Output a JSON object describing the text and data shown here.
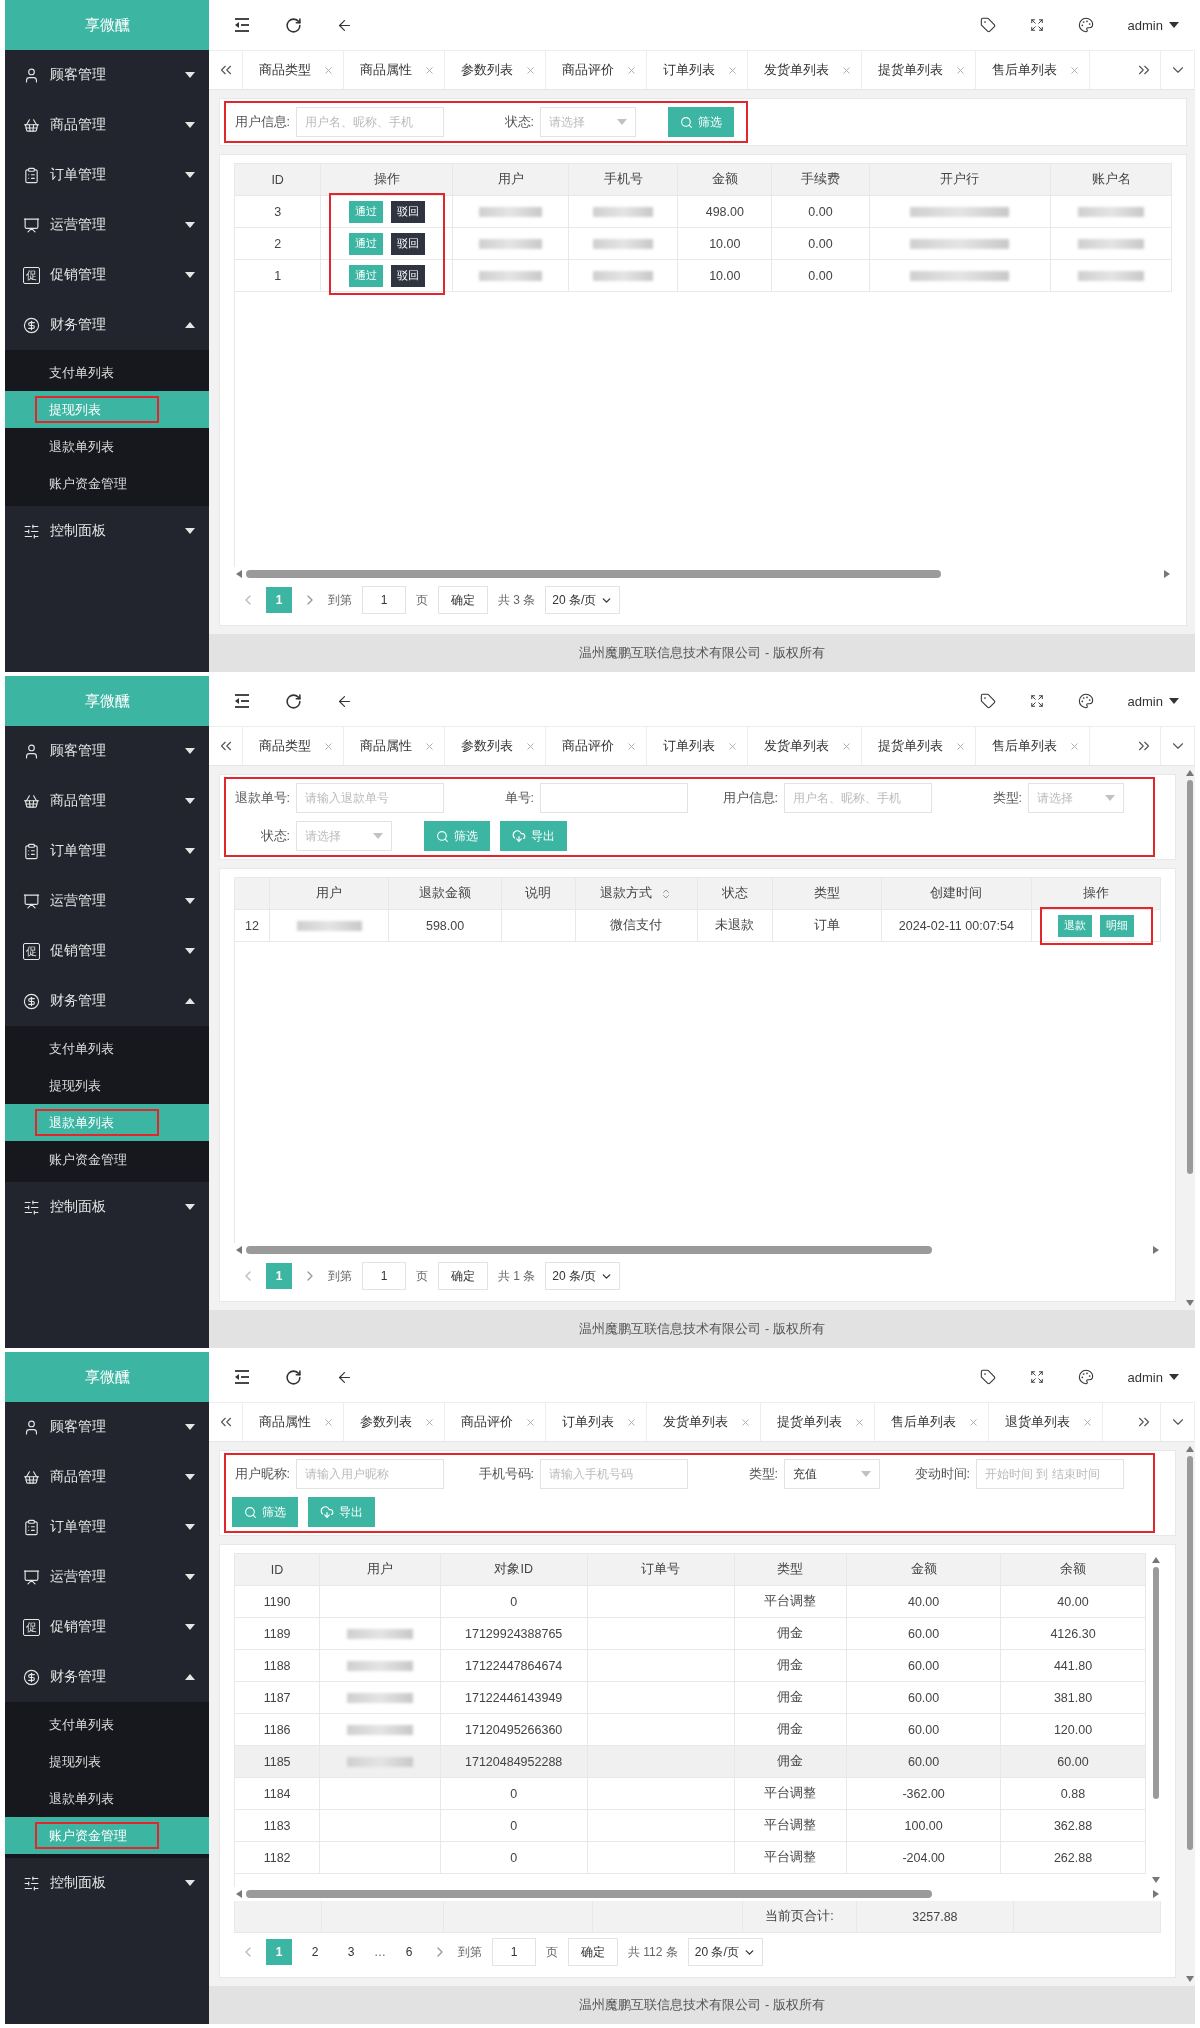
{
  "panels": [
    {
      "brand": "享微醺",
      "user": "admin",
      "content_scrollbar": false,
      "menu": [
        {
          "label": "顾客管理",
          "kind": "user",
          "expanded": false
        },
        {
          "label": "商品管理",
          "kind": "basket",
          "expanded": false
        },
        {
          "label": "订单管理",
          "kind": "clipboard",
          "expanded": false
        },
        {
          "label": "运营管理",
          "kind": "presentation",
          "expanded": false
        },
        {
          "label": "促销管理",
          "kind": "glyph",
          "glyph": "促",
          "expanded": false
        },
        {
          "label": "财务管理",
          "kind": "finance",
          "expanded": true,
          "children": [
            {
              "label": "支付单列表",
              "selected": false,
              "highlighted": false
            },
            {
              "label": "提现列表",
              "selected": true,
              "highlighted": true
            },
            {
              "label": "退款单列表",
              "selected": false,
              "highlighted": false
            },
            {
              "label": "账户资金管理",
              "selected": false,
              "highlighted": false
            }
          ]
        },
        {
          "label": "控制面板",
          "kind": "panel",
          "expanded": false
        }
      ],
      "tabs": [
        "商品类型",
        "商品属性",
        "参数列表",
        "商品评价",
        "订单列表",
        "发货单列表",
        "提货单列表",
        "售后单列表"
      ],
      "filters": {
        "highlighted": true,
        "fields": [
          {
            "kind": "input",
            "label": "用户信息:",
            "placeholder": "用户名、昵称、手机"
          },
          {
            "kind": "select",
            "label": "状态:",
            "placeholder": "请选择"
          }
        ],
        "buttons": [
          {
            "kind": "search",
            "label": "筛选"
          }
        ]
      },
      "table": {
        "vertical_scrollbar": false,
        "columns": [
          {
            "label": "ID",
            "sortable": false,
            "highlighted": false
          },
          {
            "label": "操作",
            "sortable": false,
            "highlighted": true
          },
          {
            "label": "用户",
            "sortable": false,
            "highlighted": false
          },
          {
            "label": "手机号",
            "sortable": false,
            "highlighted": false
          },
          {
            "label": "金额",
            "sortable": false,
            "highlighted": false
          },
          {
            "label": "手续费",
            "sortable": false,
            "highlighted": false
          },
          {
            "label": "开户行",
            "sortable": false,
            "highlighted": false
          },
          {
            "label": "账户名",
            "sortable": false,
            "highlighted": false
          }
        ],
        "rows": [
          {
            "highlighted": false,
            "cells": [
              "3",
              {
                "kind": "actions",
                "buttons": [
                  {
                    "label": "通过",
                    "kind": "primary"
                  },
                  {
                    "label": "驳回",
                    "kind": "dark"
                  }
                ]
              },
              {
                "kind": "blurred"
              },
              {
                "kind": "blurred"
              },
              "498.00",
              "0.00",
              {
                "kind": "blurred"
              },
              {
                "kind": "blurred"
              }
            ]
          },
          {
            "highlighted": false,
            "cells": [
              "2",
              {
                "kind": "actions",
                "buttons": [
                  {
                    "label": "通过",
                    "kind": "primary"
                  },
                  {
                    "label": "驳回",
                    "kind": "dark"
                  }
                ]
              },
              {
                "kind": "blurred"
              },
              {
                "kind": "blurred"
              },
              "10.00",
              "0.00",
              {
                "kind": "blurred"
              },
              {
                "kind": "blurred"
              }
            ]
          },
          {
            "highlighted": false,
            "cells": [
              "1",
              {
                "kind": "actions",
                "buttons": [
                  {
                    "label": "通过",
                    "kind": "primary"
                  },
                  {
                    "label": "驳回",
                    "kind": "dark"
                  }
                ]
              },
              {
                "kind": "blurred"
              },
              {
                "kind": "blurred"
              },
              "10.00",
              "0.00",
              {
                "kind": "blurred"
              },
              {
                "kind": "blurred"
              }
            ]
          }
        ]
      },
      "pagination": {
        "pages": [
          {
            "kind": "page",
            "label": "1",
            "selected": true
          }
        ],
        "goto_label": "到第",
        "goto_value": "1",
        "goto_suffix": "页",
        "confirm": "确定",
        "total": "共 3 条",
        "page_size": "20 条/页"
      },
      "footer": "温州魔鹏互联信息技术有限公司 - 版权所有"
    },
    {
      "brand": "享微醺",
      "user": "admin",
      "content_scrollbar": true,
      "menu": [
        {
          "label": "顾客管理",
          "kind": "user",
          "expanded": false
        },
        {
          "label": "商品管理",
          "kind": "basket",
          "expanded": false
        },
        {
          "label": "订单管理",
          "kind": "clipboard",
          "expanded": false
        },
        {
          "label": "运营管理",
          "kind": "presentation",
          "expanded": false
        },
        {
          "label": "促销管理",
          "kind": "glyph",
          "glyph": "促",
          "expanded": false
        },
        {
          "label": "财务管理",
          "kind": "finance",
          "expanded": true,
          "children": [
            {
              "label": "支付单列表",
              "selected": false,
              "highlighted": false
            },
            {
              "label": "提现列表",
              "selected": false,
              "highlighted": false
            },
            {
              "label": "退款单列表",
              "selected": true,
              "highlighted": true
            },
            {
              "label": "账户资金管理",
              "selected": false,
              "highlighted": false
            }
          ]
        },
        {
          "label": "控制面板",
          "kind": "panel",
          "expanded": false
        }
      ],
      "tabs": [
        "商品类型",
        "商品属性",
        "参数列表",
        "商品评价",
        "订单列表",
        "发货单列表",
        "提货单列表",
        "售后单列表"
      ],
      "filters": {
        "highlighted": true,
        "fields": [
          {
            "kind": "input",
            "label": "退款单号:",
            "placeholder": "请输入退款单号"
          },
          {
            "kind": "input",
            "label": "单号:"
          },
          {
            "kind": "input",
            "label": "用户信息:",
            "placeholder": "用户名、昵称、手机"
          },
          {
            "kind": "select",
            "label": "类型:",
            "placeholder": "请选择"
          },
          {
            "kind": "select",
            "label": "状态:",
            "placeholder": "请选择"
          }
        ],
        "buttons": [
          {
            "kind": "search",
            "label": "筛选"
          },
          {
            "kind": "export",
            "label": "导出"
          }
        ]
      },
      "table": {
        "vertical_scrollbar": false,
        "columns": [
          {
            "sortable": false,
            "highlighted": false
          },
          {
            "label": "用户",
            "sortable": false,
            "highlighted": false
          },
          {
            "label": "退款金额",
            "sortable": false,
            "highlighted": false
          },
          {
            "label": "说明",
            "sortable": false,
            "highlighted": false
          },
          {
            "label": "退款方式",
            "sortable": true,
            "highlighted": false
          },
          {
            "label": "状态",
            "sortable": false,
            "highlighted": false
          },
          {
            "label": "类型",
            "sortable": false,
            "highlighted": false
          },
          {
            "label": "创建时间",
            "sortable": false,
            "highlighted": false
          },
          {
            "label": "操作",
            "sortable": false,
            "highlighted": true
          }
        ],
        "rows": [
          {
            "highlighted": false,
            "cells": [
              "12",
              {
                "kind": "blurred"
              },
              "598.00",
              {
                "kind": "blank"
              },
              "微信支付",
              "未退款",
              "订单",
              "2024-02-11 00:07:54",
              {
                "kind": "actions",
                "buttons": [
                  {
                    "label": "退款",
                    "kind": "primary"
                  },
                  {
                    "label": "明细",
                    "kind": "primary"
                  }
                ]
              }
            ]
          }
        ]
      },
      "pagination": {
        "pages": [
          {
            "kind": "page",
            "label": "1",
            "selected": true
          }
        ],
        "goto_label": "到第",
        "goto_value": "1",
        "goto_suffix": "页",
        "confirm": "确定",
        "total": "共 1 条",
        "page_size": "20 条/页"
      },
      "footer": "温州魔鹏互联信息技术有限公司 - 版权所有"
    },
    {
      "brand": "享微醺",
      "user": "admin",
      "content_scrollbar": true,
      "menu": [
        {
          "label": "顾客管理",
          "kind": "user",
          "expanded": false
        },
        {
          "label": "商品管理",
          "kind": "basket",
          "expanded": false
        },
        {
          "label": "订单管理",
          "kind": "clipboard",
          "expanded": false
        },
        {
          "label": "运营管理",
          "kind": "presentation",
          "expanded": false
        },
        {
          "label": "促销管理",
          "kind": "glyph",
          "glyph": "促",
          "expanded": false
        },
        {
          "label": "财务管理",
          "kind": "finance",
          "expanded": true,
          "children": [
            {
              "label": "支付单列表",
              "selected": false,
              "highlighted": false
            },
            {
              "label": "提现列表",
              "selected": false,
              "highlighted": false
            },
            {
              "label": "退款单列表",
              "selected": false,
              "highlighted": false
            },
            {
              "label": "账户资金管理",
              "selected": true,
              "highlighted": true
            }
          ]
        },
        {
          "label": "控制面板",
          "kind": "panel",
          "expanded": false
        }
      ],
      "tabs": [
        "商品属性",
        "参数列表",
        "商品评价",
        "订单列表",
        "发货单列表",
        "提货单列表",
        "售后单列表",
        "退货单列表"
      ],
      "filters": {
        "highlighted": true,
        "fields": [
          {
            "kind": "input",
            "label": "用户昵称:",
            "placeholder": "请输入用户昵称"
          },
          {
            "kind": "input",
            "label": "手机号码:",
            "placeholder": "请输入手机号码"
          },
          {
            "kind": "select",
            "label": "类型:",
            "value": "充值"
          },
          {
            "kind": "input",
            "label": "变动时间:",
            "placeholder": "开始时间 到 结束时间"
          }
        ],
        "buttons": [
          {
            "kind": "search",
            "label": "筛选"
          },
          {
            "kind": "export",
            "label": "导出"
          }
        ]
      },
      "table": {
        "vertical_scrollbar": true,
        "columns": [
          {
            "label": "ID",
            "sortable": false,
            "highlighted": false
          },
          {
            "label": "用户",
            "sortable": false,
            "highlighted": false
          },
          {
            "label": "对象ID",
            "sortable": false,
            "highlighted": false
          },
          {
            "label": "订单号",
            "sortable": false,
            "highlighted": false
          },
          {
            "label": "类型",
            "sortable": false,
            "highlighted": false
          },
          {
            "label": "金额",
            "sortable": false,
            "highlighted": false
          },
          {
            "label": "余额",
            "sortable": false,
            "highlighted": false
          }
        ],
        "rows": [
          {
            "highlighted": false,
            "cells": [
              "1190",
              {
                "kind": "blank"
              },
              "0",
              {
                "kind": "blank"
              },
              "平台调整",
              "40.00",
              "40.00"
            ]
          },
          {
            "highlighted": false,
            "cells": [
              "1189",
              {
                "kind": "blurred"
              },
              "17129924388765",
              {
                "kind": "blank"
              },
              "佣金",
              "60.00",
              "4126.30"
            ]
          },
          {
            "highlighted": false,
            "cells": [
              "1188",
              {
                "kind": "blurred"
              },
              "17122447864674",
              {
                "kind": "blank"
              },
              "佣金",
              "60.00",
              "441.80"
            ]
          },
          {
            "highlighted": false,
            "cells": [
              "1187",
              {
                "kind": "blurred"
              },
              "17122446143949",
              {
                "kind": "blank"
              },
              "佣金",
              "60.00",
              "381.80"
            ]
          },
          {
            "highlighted": false,
            "cells": [
              "1186",
              {
                "kind": "blurred"
              },
              "17120495266360",
              {
                "kind": "blank"
              },
              "佣金",
              "60.00",
              "120.00"
            ]
          },
          {
            "highlighted": true,
            "cells": [
              "1185",
              {
                "kind": "blurred"
              },
              "17120484952288",
              {
                "kind": "blank"
              },
              "佣金",
              "60.00",
              "60.00"
            ]
          },
          {
            "highlighted": false,
            "cells": [
              "1184",
              {
                "kind": "blank"
              },
              "0",
              {
                "kind": "blank"
              },
              "平台调整",
              "-362.00",
              "0.88"
            ]
          },
          {
            "highlighted": false,
            "cells": [
              "1183",
              {
                "kind": "blank"
              },
              "0",
              {
                "kind": "blank"
              },
              "平台调整",
              "100.00",
              "362.88"
            ]
          },
          {
            "highlighted": false,
            "cells": [
              "1182",
              {
                "kind": "blank"
              },
              "0",
              {
                "kind": "blank"
              },
              "平台调整",
              "-204.00",
              "262.88"
            ]
          }
        ],
        "summary": [
          {
            "kind": "blank"
          },
          {
            "kind": "blank"
          },
          {
            "kind": "blank"
          },
          {
            "kind": "blank"
          },
          "当前页合计:",
          "3257.88",
          {
            "kind": "blank"
          }
        ]
      },
      "pagination": {
        "pages": [
          {
            "kind": "page",
            "label": "1",
            "selected": true
          },
          {
            "kind": "page",
            "label": "2",
            "selected": false
          },
          {
            "kind": "page",
            "label": "3",
            "selected": false
          },
          {
            "kind": "ellipsis",
            "label": "…"
          },
          {
            "kind": "page",
            "label": "6",
            "selected": false
          }
        ],
        "goto_label": "到第",
        "goto_value": "1",
        "goto_suffix": "页",
        "confirm": "确定",
        "total": "共 112 条",
        "page_size": "20 条/页"
      },
      "footer": "温州魔鹏互联信息技术有限公司 - 版权所有"
    }
  ]
}
